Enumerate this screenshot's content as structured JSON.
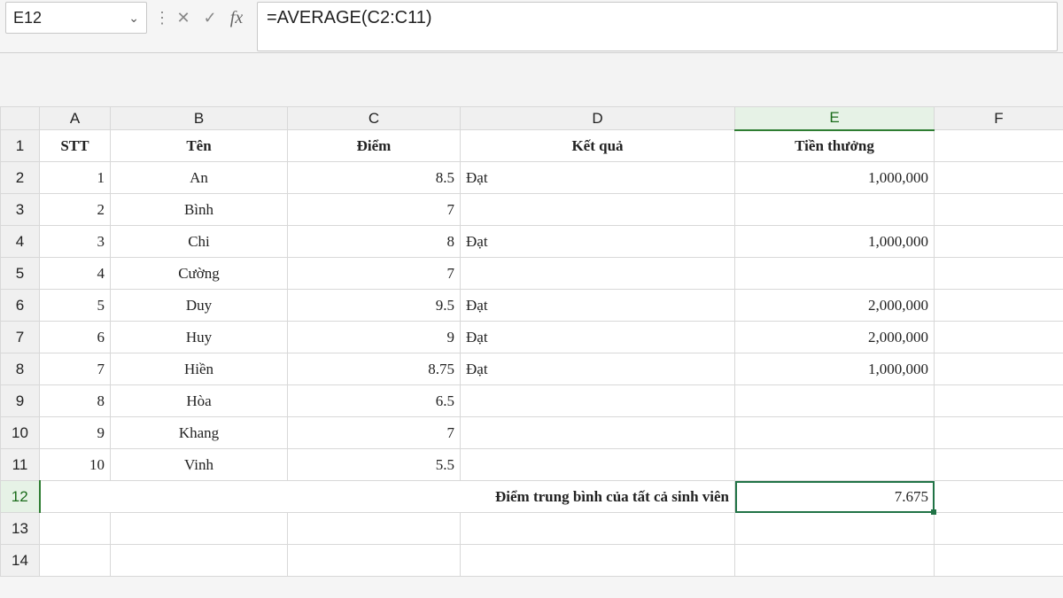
{
  "formula_bar": {
    "cell_ref": "E12",
    "formula": "=AVERAGE(C2:C11)"
  },
  "columns": [
    "A",
    "B",
    "C",
    "D",
    "E",
    "F"
  ],
  "selected_col": "E",
  "selected_row": "12",
  "row_labels": [
    "1",
    "2",
    "3",
    "4",
    "5",
    "6",
    "7",
    "8",
    "9",
    "10",
    "11",
    "12",
    "13",
    "14"
  ],
  "headers": {
    "A": "STT",
    "B": "Tên",
    "C": "Điểm",
    "D": "Kết quả",
    "E": "Tiền thưởng"
  },
  "rows": [
    {
      "stt": "1",
      "ten": "An",
      "diem": "8.5",
      "kq": "Đạt",
      "tt": "1,000,000"
    },
    {
      "stt": "2",
      "ten": "Bình",
      "diem": "7",
      "kq": "",
      "tt": ""
    },
    {
      "stt": "3",
      "ten": "Chi",
      "diem": "8",
      "kq": "Đạt",
      "tt": "1,000,000"
    },
    {
      "stt": "4",
      "ten": "Cường",
      "diem": "7",
      "kq": "",
      "tt": ""
    },
    {
      "stt": "5",
      "ten": "Duy",
      "diem": "9.5",
      "kq": "Đạt",
      "tt": "2,000,000"
    },
    {
      "stt": "6",
      "ten": "Huy",
      "diem": "9",
      "kq": "Đạt",
      "tt": "2,000,000"
    },
    {
      "stt": "7",
      "ten": "Hiền",
      "diem": "8.75",
      "kq": "Đạt",
      "tt": "1,000,000"
    },
    {
      "stt": "8",
      "ten": "Hòa",
      "diem": "6.5",
      "kq": "",
      "tt": ""
    },
    {
      "stt": "9",
      "ten": "Khang",
      "diem": "7",
      "kq": "",
      "tt": ""
    },
    {
      "stt": "10",
      "ten": "Vinh",
      "diem": "5.5",
      "kq": "",
      "tt": ""
    }
  ],
  "summary": {
    "label": "Điểm trung bình của tất cả sinh viên",
    "value": "7.675"
  },
  "chart_data": {
    "type": "table",
    "columns": [
      "STT",
      "Tên",
      "Điểm",
      "Kết quả",
      "Tiền thưởng"
    ],
    "rows": [
      [
        1,
        "An",
        8.5,
        "Đạt",
        1000000
      ],
      [
        2,
        "Bình",
        7,
        "",
        null
      ],
      [
        3,
        "Chi",
        8,
        "Đạt",
        1000000
      ],
      [
        4,
        "Cường",
        7,
        "",
        null
      ],
      [
        5,
        "Duy",
        9.5,
        "Đạt",
        2000000
      ],
      [
        6,
        "Huy",
        9,
        "Đạt",
        2000000
      ],
      [
        7,
        "Hiền",
        8.75,
        "Đạt",
        1000000
      ],
      [
        8,
        "Hòa",
        6.5,
        "",
        null
      ],
      [
        9,
        "Khang",
        7,
        "",
        null
      ],
      [
        10,
        "Vinh",
        5.5,
        "",
        null
      ]
    ],
    "summary": {
      "label": "Điểm trung bình của tất cả sinh viên",
      "value": 7.675
    }
  }
}
